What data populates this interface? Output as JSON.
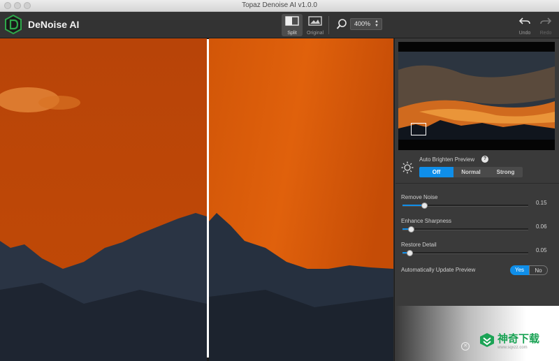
{
  "window": {
    "title": "Topaz Denoise AI v1.0.0"
  },
  "app": {
    "name": "DeNoise AI"
  },
  "toolbar": {
    "split_label": "Split",
    "original_label": "Original",
    "zoom_value": "400%",
    "undo_label": "Undo",
    "redo_label": "Redo"
  },
  "preview": {
    "brighten_label": "Auto Brighten Preview",
    "help_glyph": "?",
    "options": [
      "Off",
      "Normal",
      "Strong"
    ],
    "selected": "Off"
  },
  "sliders": [
    {
      "label": "Remove Noise",
      "value": "0.15",
      "fraction": 0.15
    },
    {
      "label": "Enhance Sharpness",
      "value": "0.06",
      "fraction": 0.06
    },
    {
      "label": "Restore Detail",
      "value": "0.05",
      "fraction": 0.05
    }
  ],
  "auto_update": {
    "label": "Automatically Update Preview",
    "yes": "Yes",
    "no": "No",
    "selected": "Yes"
  },
  "watermark": {
    "text": "神奇下载",
    "url": "www.sqxzz.com",
    "close_glyph": "✕"
  },
  "colors": {
    "accent": "#0f8ee9",
    "sky": "#c84a07",
    "brand_green": "#1ba355"
  }
}
